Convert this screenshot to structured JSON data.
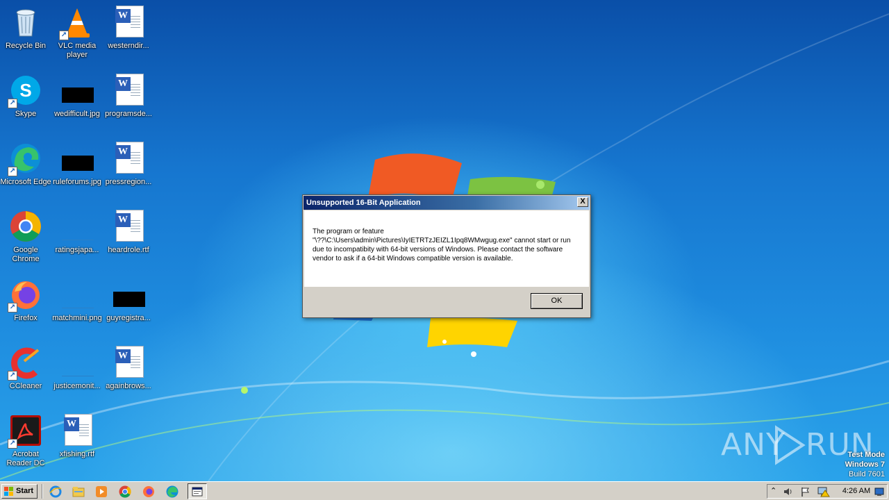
{
  "desktop": {
    "icons": [
      {
        "label": "Recycle Bin"
      },
      {
        "label": "VLC media player"
      },
      {
        "label": "westerndir..."
      },
      {
        "label": "Skype"
      },
      {
        "label": "wedifficult.jpg"
      },
      {
        "label": "programsde..."
      },
      {
        "label": "Microsoft Edge"
      },
      {
        "label": "ruleforums.jpg"
      },
      {
        "label": "pressregion..."
      },
      {
        "label": "Google Chrome"
      },
      {
        "label": "ratingsjapa..."
      },
      {
        "label": "heardrole.rtf"
      },
      {
        "label": "Firefox"
      },
      {
        "label": "matchmini.png"
      },
      {
        "label": "guyregistra..."
      },
      {
        "label": "CCleaner"
      },
      {
        "label": "justicemonit..."
      },
      {
        "label": "againbrows..."
      },
      {
        "label": "Acrobat Reader DC"
      },
      {
        "label": "xfishing.rtf"
      }
    ]
  },
  "dialog": {
    "title": "Unsupported 16-Bit Application",
    "close_glyph": "X",
    "message_line1": "The program or feature",
    "message_rest": "\"\\??\\C:\\Users\\admin\\Pictures\\IyIETRTzJEIZL1Ipq8WMwgug.exe\" cannot start or run due to incompatibity with 64-bit versions of Windows. Please contact the software vendor to ask if a 64-bit Windows compatible version is available.",
    "ok_label": "OK"
  },
  "watermark": {
    "brand_left": "ANY",
    "brand_right": "RUN",
    "test_mode": "Test Mode",
    "os_name": "Windows 7",
    "build": "Build 7601"
  },
  "taskbar": {
    "start_label": "Start",
    "clock": "4:26 AM"
  },
  "colors": {
    "title_bar_start": "#0a246a",
    "title_bar_end": "#a6caf0",
    "classic_gray": "#d4d0c8",
    "desktop_blue": "#1f7fd4"
  }
}
